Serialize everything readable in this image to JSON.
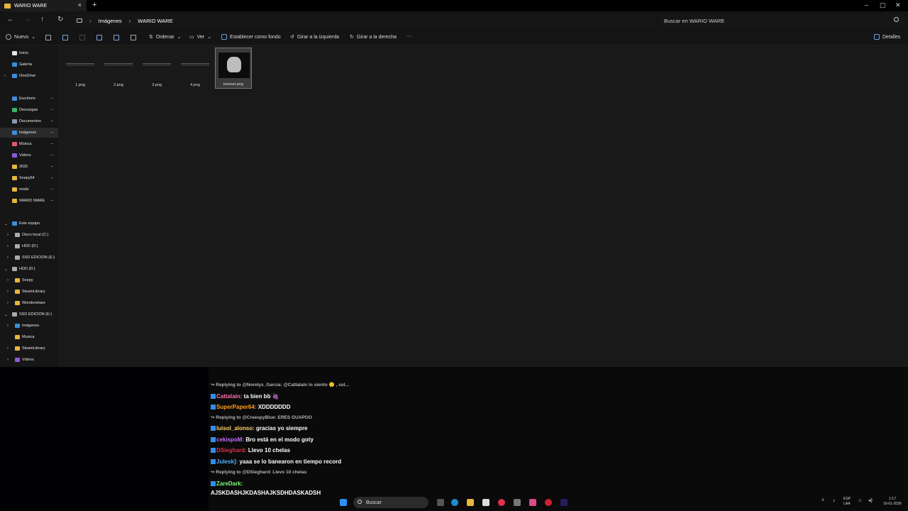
{
  "window": {
    "tab_title": "WARIO WARE",
    "tab_close": "×",
    "new_tab": "+",
    "controls": [
      "–",
      "▢",
      "✕"
    ]
  },
  "address": {
    "crumbs": [
      "Imágenes",
      "WARIO WARE"
    ],
    "separator": "›",
    "search_placeholder": "Buscar en WARIO WARE"
  },
  "commands": {
    "new": "Nuevo",
    "sort": "Ordenar",
    "view": "Ver",
    "set_background": "Establecer como fondo",
    "rotate_left": "Girar a la izquierda",
    "rotate_right": "Girar a la derecha",
    "more": "···",
    "details": "Detalles"
  },
  "nav": {
    "items": [
      {
        "label": "Inicio",
        "icon": "home-icon",
        "color": "#e8e8e8"
      },
      {
        "label": "Galería",
        "icon": "gallery-icon",
        "color": "#3a8fd8"
      },
      {
        "label": "OneDrive",
        "icon": "cloud-icon",
        "color": "#3a8fd8"
      },
      {
        "label": "Escritorio",
        "icon": "desktop-icon",
        "color": "#3a8fd8"
      },
      {
        "label": "Descargas",
        "icon": "download-icon",
        "color": "#3bb36a"
      },
      {
        "label": "Documentos",
        "icon": "document-icon",
        "color": "#8a9bb5"
      },
      {
        "label": "Imágenes",
        "icon": "pictures-icon",
        "color": "#3a8fd8"
      },
      {
        "label": "Música",
        "icon": "music-icon",
        "color": "#e0566c"
      },
      {
        "label": "Videos",
        "icon": "video-icon",
        "color": "#8a5bd6"
      },
      {
        "label": "2025",
        "icon": "folder-icon",
        "color": "#e8b73b"
      },
      {
        "label": "Snepy64",
        "icon": "folder-icon",
        "color": "#e8b73b"
      },
      {
        "label": "mods",
        "icon": "folder-icon",
        "color": "#e8b73b"
      },
      {
        "label": "WARIO WARE",
        "icon": "folder-icon",
        "color": "#e8b73b"
      },
      {
        "label": "Este equipo",
        "icon": "computer-icon",
        "color": "#3a8fd8"
      },
      {
        "label": "Disco local (C:)",
        "icon": "drive-icon",
        "color": "#aaaaaa"
      },
      {
        "label": "HDD (D:)",
        "icon": "drive-icon",
        "color": "#aaaaaa"
      },
      {
        "label": "SSD EDICION (E:)",
        "icon": "drive-icon",
        "color": "#aaaaaa"
      },
      {
        "label": "HDD (D:)",
        "icon": "drive-icon",
        "color": "#aaaaaa"
      },
      {
        "label": "Snepy",
        "icon": "folder-icon",
        "color": "#e8b73b"
      },
      {
        "label": "SteamLibrary",
        "icon": "folder-icon",
        "color": "#e8b73b"
      },
      {
        "label": "Wondershare",
        "icon": "folder-icon",
        "color": "#e8b73b"
      },
      {
        "label": "SSD EDICION (E:)",
        "icon": "drive-icon",
        "color": "#aaaaaa"
      },
      {
        "label": "Imágenes",
        "icon": "pictures-icon",
        "color": "#3a8fd8"
      },
      {
        "label": "Musica",
        "icon": "folder-icon",
        "color": "#e8b73b"
      },
      {
        "label": "SteamLibrary",
        "icon": "folder-icon",
        "color": "#e8b73b"
      },
      {
        "label": "Videos",
        "icon": "video-icon",
        "color": "#8a5bd6"
      }
    ]
  },
  "files": [
    {
      "name": "1.png"
    },
    {
      "name": "2.png"
    },
    {
      "name": "3.png"
    },
    {
      "name": "4.png"
    },
    {
      "name": "bowser.png"
    }
  ],
  "chat": [
    {
      "type": "reply",
      "text": "Replying to @Norelys_Garcia: @Cattalain lo siento 🙂 , sol..."
    },
    {
      "type": "msg",
      "user": "Cattalain:",
      "user_color": "#ff6fb5",
      "text": "ta bien bb 🍇"
    },
    {
      "type": "msg",
      "user": "SuperPaper64:",
      "user_color": "#ff9f1a",
      "text": "XDDDDDDD"
    },
    {
      "type": "reply",
      "text": "Replying to @CreespyBlue: ERES GUAPOO"
    },
    {
      "type": "msg",
      "user": "luisol_alonso:",
      "user_color": "#ffd36b",
      "text": "gracias yo siempre"
    },
    {
      "type": "msg",
      "user": "cekispoM:",
      "user_color": "#c46bff",
      "text": "Bro está en el modo goty"
    },
    {
      "type": "msg",
      "user": "DSieghard:",
      "user_color": "#e0304a",
      "text": "Llevo 10 chelas"
    },
    {
      "type": "msg",
      "user": "Julesk]:",
      "user_color": "#4fb3ff",
      "text": "yaaa se lo banearon en tiempo record"
    },
    {
      "type": "reply",
      "text": "Replying to @DSieghard: Llevo 10 chelas"
    },
    {
      "type": "msg",
      "user": "ZareDark:",
      "user_color": "#7dff7a",
      "text": ""
    },
    {
      "type": "msg",
      "user": "",
      "user_color": "#ffffff",
      "text": "AJSKDASHJKDASHAJKSDHDASKADSH"
    }
  ],
  "taskbar": {
    "search_label": "Buscar",
    "lang_top": "ESP",
    "lang_bottom": "LAA",
    "time": "1:17",
    "date": "16-01-2026"
  }
}
